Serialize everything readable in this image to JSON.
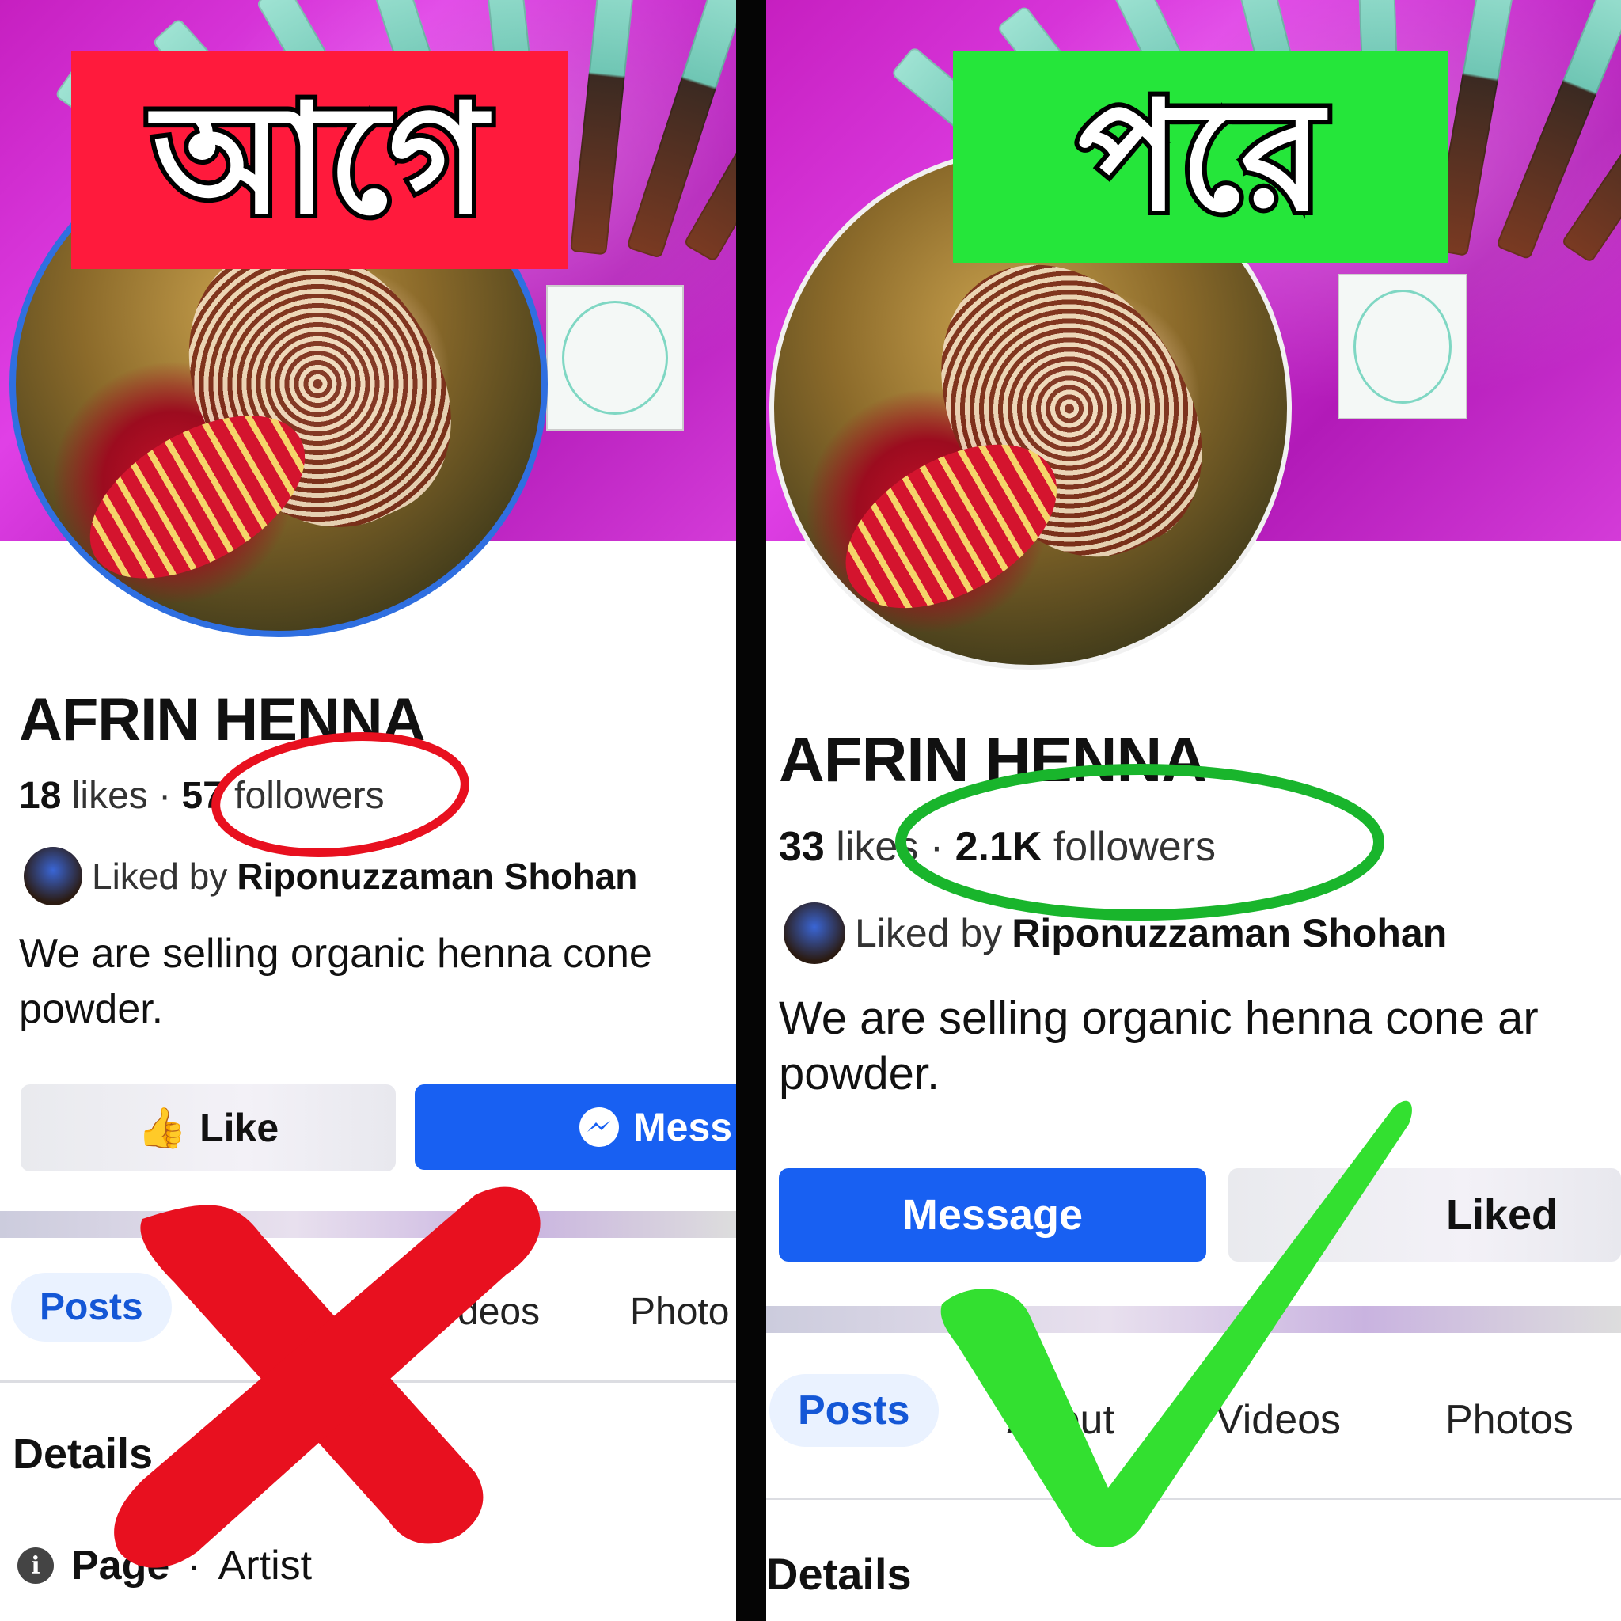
{
  "colors": {
    "before_banner": "#ff1a3c",
    "after_banner": "#25e63a",
    "before_mark": "#e8101f",
    "after_mark": "#33e030",
    "facebook_blue": "#1860f2"
  },
  "before": {
    "banner": "আগে",
    "page_name": "AFRIN HENNA",
    "likes": "18",
    "likes_label": "likes",
    "followers": "57",
    "followers_label": "followers",
    "liked_by_prefix": "Liked by",
    "liked_by_name": "Riponuzzaman Shohan",
    "description": "We are selling organic henna cone\npowder.",
    "like_button": "Like",
    "message_button": "Mess",
    "tabs": [
      "Posts",
      "deos",
      "Photo"
    ],
    "section_title": "Details",
    "page_type_prefix": "Page",
    "page_type": "Artist",
    "mark_icon": "cross-mark-icon"
  },
  "after": {
    "banner": "পরে",
    "page_name": "AFRIN HENNA",
    "likes": "33",
    "likes_label": "likes",
    "followers": "2.1K",
    "followers_label": "followers",
    "liked_by_prefix": "Liked by",
    "liked_by_name": "Riponuzzaman Shohan",
    "description": "We are selling organic henna cone ar\npowder.",
    "message_button": "Message",
    "liked_button": "Liked",
    "tabs": [
      "Posts",
      "About",
      "Videos",
      "Photos"
    ],
    "section_title": "Details",
    "mark_icon": "check-mark-icon"
  }
}
